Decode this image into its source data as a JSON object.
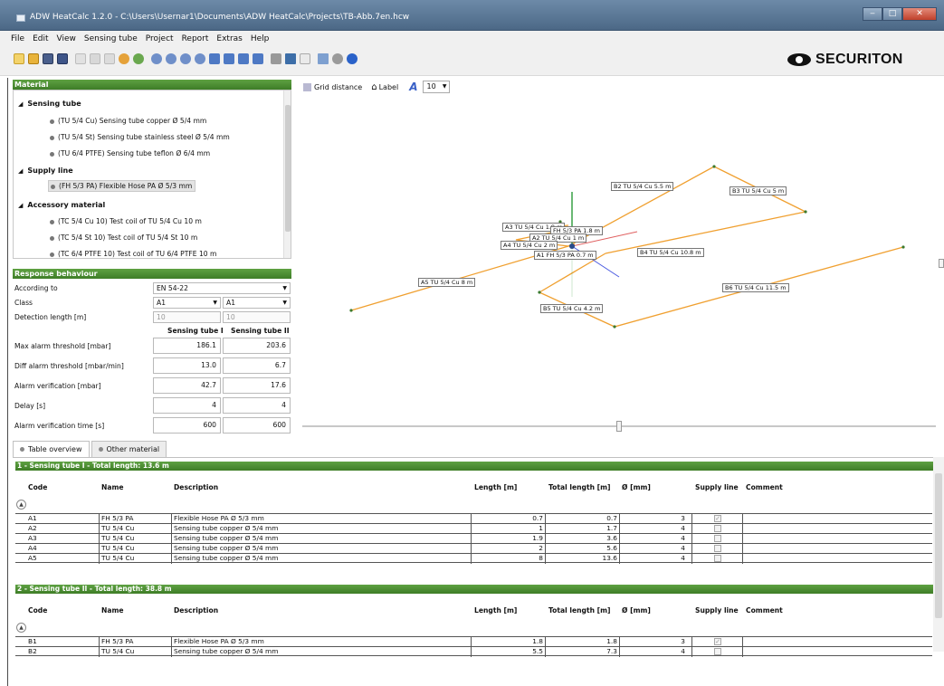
{
  "window": {
    "title": "ADW HeatCalc 1.2.0 - C:\\Users\\Usernar1\\Documents\\ADW HeatCalc\\Projects\\TB-Abb.7en.hcw",
    "minimize": "‒",
    "maximize": "□",
    "close": "✕"
  },
  "menu": [
    "File",
    "Edit",
    "View",
    "Sensing tube",
    "Project",
    "Report",
    "Extras",
    "Help"
  ],
  "logo_text": "SECURITON",
  "material": {
    "header": "Material",
    "categories": [
      {
        "label": "Sensing tube",
        "items": [
          "(TU 5/4 Cu) Sensing tube copper Ø 5/4 mm",
          "(TU 5/4 St) Sensing tube stainless steel Ø 5/4 mm",
          "(TU 6/4 PTFE) Sensing tube teflon Ø 6/4 mm"
        ]
      },
      {
        "label": "Supply line",
        "items": [
          "(FH 5/3 PA) Flexible Hose PA Ø 5/3 mm"
        ]
      },
      {
        "label": "Accessory material",
        "items": [
          "(TC 5/4 Cu 10) Test coil of TU 5/4 Cu 10 m",
          "(TC 5/4 St 10) Test coil of TU 5/4 St 10 m",
          "(TC 6/4 PTFE 10) Test coil of TU 6/4 PTFE 10 m"
        ]
      }
    ]
  },
  "response": {
    "header": "Response behaviour",
    "according_to_label": "According to",
    "according_to_value": "EN 54-22",
    "class_label": "Class",
    "class_values": [
      "A1",
      "A1"
    ],
    "detection_length_label": "Detection length [m]",
    "detection_length_values": [
      "10",
      "10"
    ],
    "col1": "Sensing tube I",
    "col2": "Sensing tube II",
    "rows": [
      {
        "label": "Max alarm threshold [mbar]",
        "v1": "186.1",
        "v2": "203.6"
      },
      {
        "label": "Diff alarm threshold [mbar/min]",
        "v1": "13.0",
        "v2": "6.7"
      },
      {
        "label": "Alarm verification [mbar]",
        "v1": "42.7",
        "v2": "17.6"
      },
      {
        "label": "Delay [s]",
        "v1": "4",
        "v2": "4"
      },
      {
        "label": "Alarm verification time [s]",
        "v1": "600",
        "v2": "600"
      }
    ]
  },
  "viewer": {
    "grid_distance": "Grid distance",
    "label_toggle": "Label",
    "zoom_value": "10",
    "tube_labels": [
      "B2 TU 5/4 Cu 5.5 m",
      "B3 TU 5/4 Cu 5 m",
      "A3 TU 5/4 Cu 1.9 m",
      "FH 5/3 PA 1.8 m",
      "A2 TU 5/4 Cu 1 m",
      "A4 TU 5/4 Cu 2 m",
      "A1 FH 5/3 PA 0.7 m",
      "B4 TU 5/4 Cu 10.8 m",
      "A5 TU 5/4 Cu 8 m",
      "B6 TU 5/4 Cu 11.5 m",
      "B5 TU 5/4 Cu 4.2 m"
    ]
  },
  "tabs": [
    "Table overview",
    "Other material"
  ],
  "table": {
    "columns": [
      "Code",
      "Name",
      "Description",
      "Length [m]",
      "Total length [m]",
      "Ø [mm]",
      "Supply line",
      "Comment"
    ],
    "groups": [
      {
        "title": "1 - Sensing tube I - Total length: 13.6 m",
        "rows": [
          {
            "code": "A1",
            "name": "FH 5/3 PA",
            "desc": "Flexible Hose PA Ø 5/3 mm",
            "len": "0.7",
            "total": "0.7",
            "dia": "3",
            "supply": "✓"
          },
          {
            "code": "A2",
            "name": "TU 5/4 Cu",
            "desc": "Sensing tube copper Ø 5/4 mm",
            "len": "1",
            "total": "1.7",
            "dia": "4",
            "supply": ""
          },
          {
            "code": "A3",
            "name": "TU 5/4 Cu",
            "desc": "Sensing tube copper Ø 5/4 mm",
            "len": "1.9",
            "total": "3.6",
            "dia": "4",
            "supply": ""
          },
          {
            "code": "A4",
            "name": "TU 5/4 Cu",
            "desc": "Sensing tube copper Ø 5/4 mm",
            "len": "2",
            "total": "5.6",
            "dia": "4",
            "supply": ""
          },
          {
            "code": "A5",
            "name": "TU 5/4 Cu",
            "desc": "Sensing tube copper Ø 5/4 mm",
            "len": "8",
            "total": "13.6",
            "dia": "4",
            "supply": ""
          }
        ]
      },
      {
        "title": "2 - Sensing tube II - Total length: 38.8 m",
        "rows": [
          {
            "code": "B1",
            "name": "FH 5/3 PA",
            "desc": "Flexible Hose PA Ø 5/3 mm",
            "len": "1.8",
            "total": "1.8",
            "dia": "3",
            "supply": "✓"
          },
          {
            "code": "B2",
            "name": "TU 5/4 Cu",
            "desc": "Sensing tube copper Ø 5/4 mm",
            "len": "5.5",
            "total": "7.3",
            "dia": "4",
            "supply": ""
          }
        ]
      }
    ]
  },
  "colors": {
    "accent_green": "#4a8c2f",
    "tube_orange": "#f0a030",
    "axis_green": "#2a9a3a",
    "axis_red": "#e06060",
    "axis_blue": "#4a5ae0"
  }
}
